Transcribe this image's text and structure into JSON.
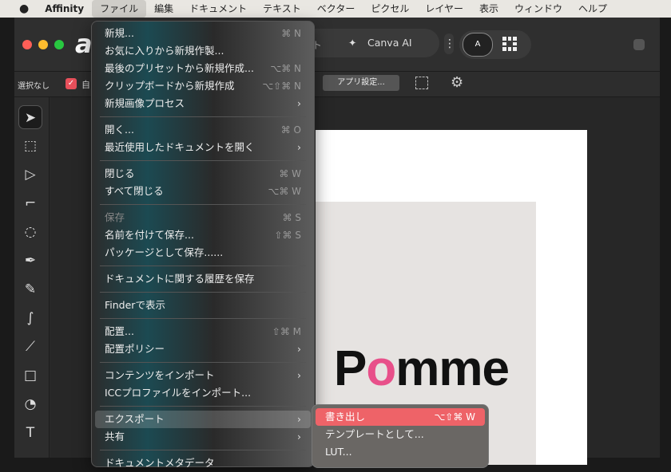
{
  "menubar": {
    "apple": "",
    "items": [
      "Affinity",
      "ファイル",
      "編集",
      "ドキュメント",
      "テキスト",
      "ベクター",
      "ピクセル",
      "レイヤー",
      "表示",
      "ウィンドウ",
      "ヘルプ"
    ]
  },
  "titlebar": {
    "logo": "a",
    "tab_partial": "ウト",
    "canva_ai": "Canva AI",
    "persona_label": "A"
  },
  "toolbar": {
    "selection": "選択なし",
    "checkbox_label": "自",
    "app_settings": "アプリ設定..."
  },
  "document": {
    "logo_text_p": "P",
    "logo_text_o": "o",
    "logo_text_rest": "mme"
  },
  "file_menu": [
    {
      "label": "新規...",
      "shortcut": "⌘ N"
    },
    {
      "label": "お気に入りから新規作製...",
      "shortcut": ""
    },
    {
      "label": "最後のプリセットから新規作成...",
      "shortcut": "⌥⌘ N"
    },
    {
      "label": "クリップボードから新規作成",
      "shortcut": "⌥⇧⌘ N"
    },
    {
      "label": "新規画像プロセス",
      "shortcut": "",
      "submenu": true
    },
    {
      "sep": true
    },
    {
      "label": "開く...",
      "shortcut": "⌘ O"
    },
    {
      "label": "最近使用したドキュメントを開く",
      "shortcut": "",
      "submenu": true
    },
    {
      "sep": true
    },
    {
      "label": "閉じる",
      "shortcut": "⌘ W"
    },
    {
      "label": "すべて閉じる",
      "shortcut": "⌥⌘ W"
    },
    {
      "sep": true
    },
    {
      "label": "保存",
      "shortcut": "⌘ S",
      "disabled": true
    },
    {
      "label": "名前を付けて保存...",
      "shortcut": "⇧⌘ S"
    },
    {
      "label": "パッケージとして保存......",
      "shortcut": ""
    },
    {
      "sep": true
    },
    {
      "label": "ドキュメントに関する履歴を保存",
      "shortcut": ""
    },
    {
      "sep": true
    },
    {
      "label": "Finderで表示",
      "shortcut": ""
    },
    {
      "sep": true
    },
    {
      "label": "配置...",
      "shortcut": "⇧⌘ M"
    },
    {
      "label": "配置ポリシー",
      "shortcut": "",
      "submenu": true
    },
    {
      "sep": true
    },
    {
      "label": "コンテンツをインポート",
      "shortcut": "",
      "submenu": true
    },
    {
      "label": "ICCプロファイルをインポート...",
      "shortcut": ""
    },
    {
      "sep": true
    },
    {
      "label": "エクスポート",
      "shortcut": "",
      "submenu": true,
      "highlighted": true
    },
    {
      "label": "共有",
      "shortcut": "",
      "submenu": true
    },
    {
      "sep": true
    },
    {
      "label": "ドキュメントメタデータ",
      "shortcut": ""
    }
  ],
  "export_submenu": [
    {
      "label": "書き出し",
      "shortcut": "⌥⇧⌘ W",
      "highlighted": true
    },
    {
      "label": "テンプレートとして...",
      "shortcut": ""
    },
    {
      "label": "LUT...",
      "shortcut": ""
    }
  ],
  "colors": {
    "accent": "#ee6368",
    "close": "#fe5f57",
    "min": "#febc2e",
    "max": "#28c840"
  }
}
